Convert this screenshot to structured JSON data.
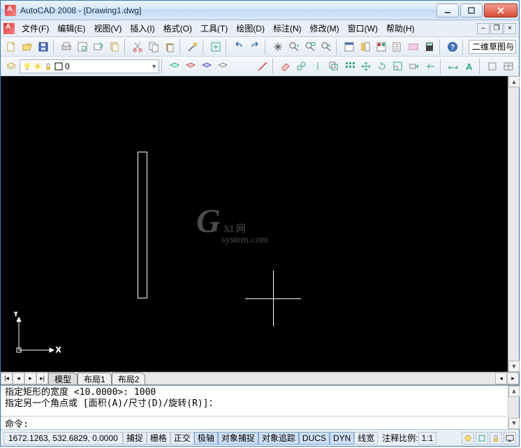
{
  "window": {
    "title": "AutoCAD 2008 - [Drawing1.dwg]"
  },
  "menu": {
    "items": [
      "文件(F)",
      "编辑(E)",
      "视图(V)",
      "插入(I)",
      "格式(O)",
      "工具(T)",
      "绘图(D)",
      "标注(N)",
      "修改(M)",
      "窗口(W)",
      "帮助(H)"
    ]
  },
  "toolbars": {
    "layer_combo": "0",
    "workspace_combo": "二维草图与"
  },
  "layout_tabs": [
    "模型",
    "布局1",
    "布局2"
  ],
  "command": {
    "history": [
      "指定矩形的宽度 <10.0000>: 1000",
      "指定另一个角点或 [面积(A)/尺寸(D)/旋转(R)]："
    ],
    "prompt": "命令:"
  },
  "status": {
    "coords": "1672.1263, 532.6829, 0.0000",
    "toggles": [
      "捕捉",
      "栅格",
      "正交",
      "极轴",
      "对象捕捉",
      "对象追踪",
      "DUCS",
      "DYN",
      "线宽"
    ],
    "active_toggles": [
      3,
      4,
      5,
      6,
      7
    ],
    "anno_label": "注释比例:",
    "anno_value": "1:1"
  },
  "watermark": {
    "big": "G",
    "suffix": "XI 网",
    "url": "system.com"
  },
  "ucs": {
    "x": "X",
    "y": "Y"
  }
}
